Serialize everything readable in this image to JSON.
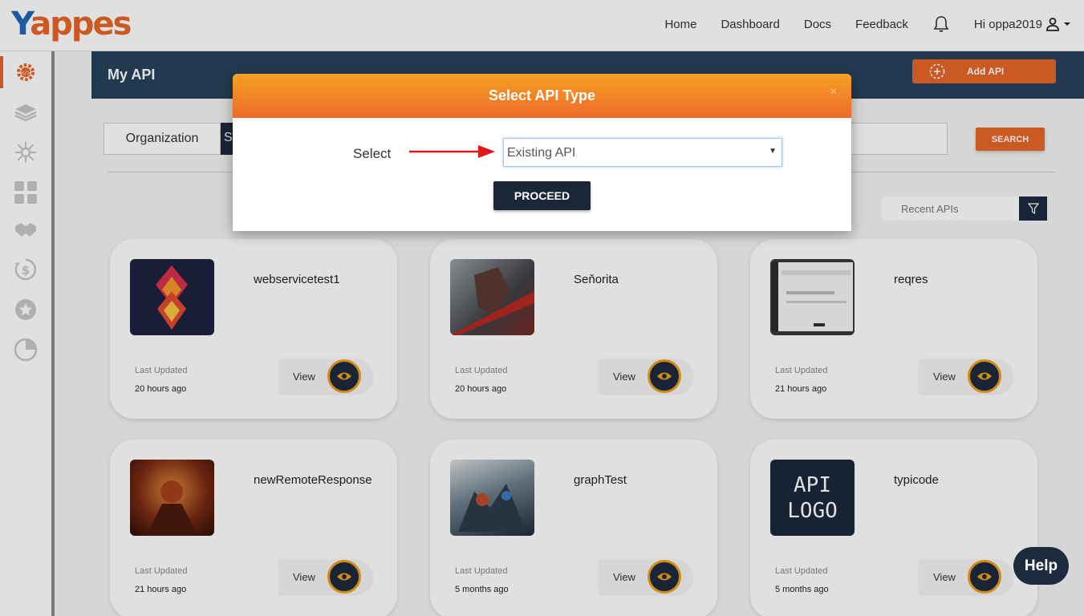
{
  "brand": {
    "logo_y": "Y",
    "logo_rest": "appes"
  },
  "nav": {
    "items": [
      "Home",
      "Dashboard",
      "Docs",
      "Feedback"
    ],
    "greeting": "Hi oppa2019"
  },
  "header": {
    "title": "My API",
    "add_api_label": "Add API"
  },
  "toolbar": {
    "organization_tab": "Organization",
    "dark_tab_partial": "S",
    "search_label": "SEARCH",
    "recent_label": "Recent APIs"
  },
  "cards": [
    {
      "name": "webservicetest1",
      "last_updated_label": "Last Updated",
      "last_updated": "20 hours ago",
      "view_label": "View"
    },
    {
      "name": "Seňorita",
      "last_updated_label": "Last Updated",
      "last_updated": "20 hours ago",
      "view_label": "View"
    },
    {
      "name": "reqres",
      "last_updated_label": "Last Updated",
      "last_updated": "21 hours ago",
      "view_label": "View"
    },
    {
      "name": "newRemoteResponse",
      "last_updated_label": "Last Updated",
      "last_updated": "21 hours ago",
      "view_label": "View"
    },
    {
      "name": "graphTest",
      "last_updated_label": "Last Updated",
      "last_updated": "5 months ago",
      "view_label": "View"
    },
    {
      "name": "typicode",
      "last_updated_label": "Last Updated",
      "last_updated": "5 months ago",
      "view_label": "View",
      "logo_text_1": "API",
      "logo_text_2": "LOGO"
    }
  ],
  "modal": {
    "title": "Select API Type",
    "close": "×",
    "select_label": "Select",
    "selected_option": "Existing API",
    "proceed_label": "PROCEED"
  },
  "help": {
    "label": "Help"
  },
  "colors": {
    "accent": "#e8662a",
    "navy": "#1d2b3e",
    "banner": "#27435a",
    "ring": "#f0a01a"
  },
  "icons": [
    "bell-icon",
    "user-icon",
    "gear-icon",
    "layers-icon",
    "network-icon",
    "grid-icon",
    "handshake-icon",
    "dollar-cycle-icon",
    "star-badge-icon",
    "pie-chart-icon",
    "filter-icon",
    "eye-icon",
    "arrow-icon"
  ]
}
